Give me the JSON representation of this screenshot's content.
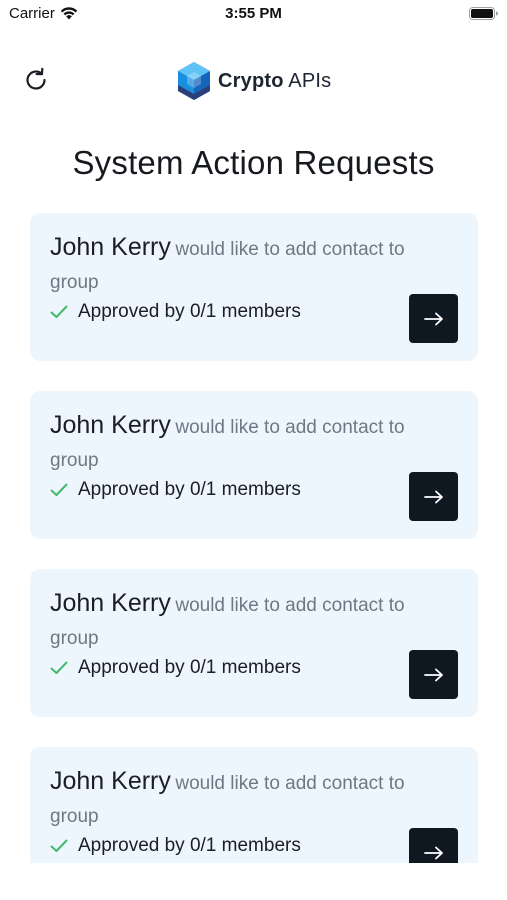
{
  "status_bar": {
    "carrier": "Carrier",
    "time": "3:55 PM"
  },
  "header": {
    "logo_bold": "Crypto",
    "logo_rest": " APIs"
  },
  "page_title": "System Action Requests",
  "colors": {
    "card_bg": "#eef6fd",
    "button_bg": "#0f1721",
    "check_green": "#43b86a",
    "logo_blue": "#1a8fe0",
    "logo_dark": "#2c3e7a"
  },
  "requests": [
    {
      "name": "John Kerry",
      "action": "would like to add contact to group",
      "approval": "Approved by 0/1 members"
    },
    {
      "name": "John Kerry",
      "action": "would like to add contact to group",
      "approval": "Approved by 0/1 members"
    },
    {
      "name": "John Kerry",
      "action": "would like to add contact to group",
      "approval": "Approved by 0/1 members"
    },
    {
      "name": "John Kerry",
      "action": "would like to add contact to group",
      "approval": "Approved by 0/1 members"
    }
  ]
}
